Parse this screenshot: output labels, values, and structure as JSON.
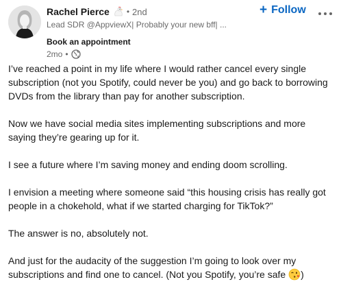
{
  "author": {
    "name": "Rachel Pierce",
    "degree": "2nd",
    "separator": "•",
    "headline": "Lead SDR @AppviewX| Probably your new bff| ...",
    "cta": "Book an appointment",
    "time": "2mo",
    "time_separator": "•"
  },
  "actions": {
    "follow_label": "Follow",
    "follow_plus": "+",
    "more_icon": "ellipsis-icon"
  },
  "colors": {
    "accent": "#0a66c2"
  },
  "post": {
    "p1": "I’ve reached a point in my life where I would rather cancel every single subscription (not you Spotify, could never be you) and go back to borrowing DVDs from the library than pay for another subscription.",
    "p2": "Now we have social media sites implementing subscriptions and more saying they’re gearing up for it.",
    "p3": "I see a future where I’m saving money and ending doom scrolling.",
    "p4": "I envision a meeting where someone said “this housing crisis has really got people in a chokehold, what if we started charging for TikTok?”",
    "p5": "The answer is no, absolutely not.",
    "p6_text": "And just for the audacity of the suggestion I’m going to look over my subscriptions and find one to cancel. (Not you Spotify, you’re safe ",
    "p6_end": ")"
  }
}
